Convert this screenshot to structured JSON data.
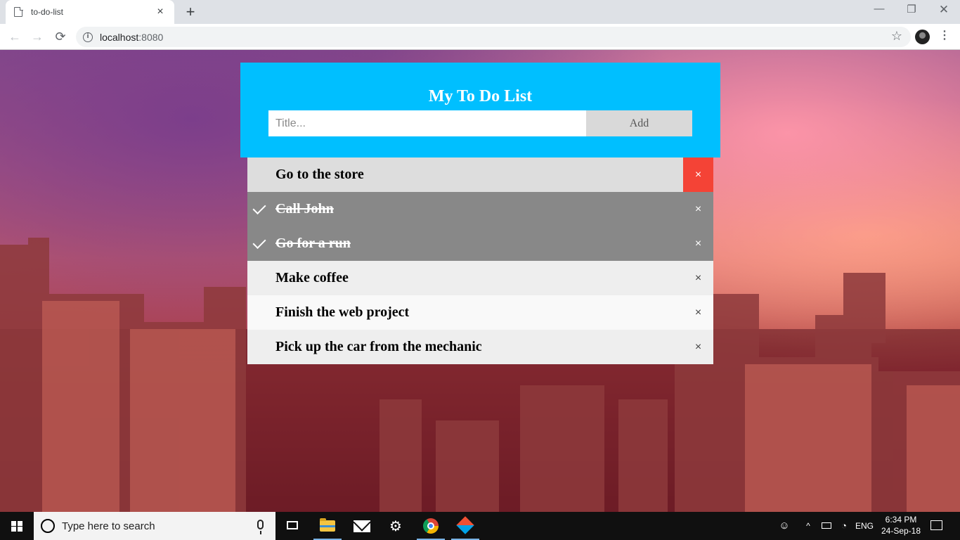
{
  "browser": {
    "tab_title": "to-do-list",
    "tab_close": "×",
    "new_tab": "+",
    "window_controls": {
      "minimize": "—",
      "restore": "❐",
      "close": "✕"
    },
    "nav": {
      "back": "←",
      "forward": "→",
      "reload": "⟳"
    },
    "url_host": "localhost",
    "url_port": ":8080",
    "info_icon": "i",
    "bookmark_icon": "☆",
    "menu_icon": "⋮"
  },
  "app": {
    "title": "My To Do List",
    "input_placeholder": "Title...",
    "input_value": "",
    "add_label": "Add",
    "close_symbol": "×",
    "items": [
      {
        "text": "Go to the store",
        "checked": false,
        "state": "hover"
      },
      {
        "text": "Call John",
        "checked": true
      },
      {
        "text": "Go for a run",
        "checked": true
      },
      {
        "text": "Make coffee",
        "checked": false
      },
      {
        "text": "Finish the web project",
        "checked": false
      },
      {
        "text": "Pick up the car from the mechanic",
        "checked": false
      }
    ],
    "colors": {
      "header_bg": "#00bfff",
      "checked_bg": "#888888",
      "close_hover_bg": "#f44336",
      "add_button_bg": "#d9d9d9"
    }
  },
  "taskbar": {
    "search_placeholder": "Type here to search",
    "apps": [
      "task-view-icon",
      "file-explorer-icon",
      "mail-icon",
      "settings-gear-icon",
      "chrome-icon",
      "git-icon"
    ],
    "language": "ENG",
    "time": "6:34 PM",
    "date": "24-Sep-18"
  }
}
